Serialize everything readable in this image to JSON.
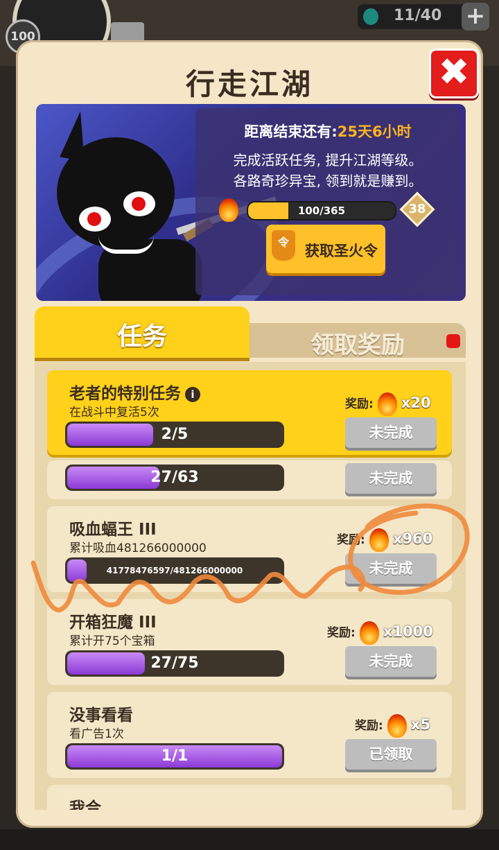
{
  "background": {
    "level": "100",
    "energy": "11/40"
  },
  "dialog": {
    "title": "行走江湖",
    "close_label": "✖"
  },
  "banner": {
    "countdown_label": "距离结束还有:",
    "countdown_value": "25天6小时",
    "desc_line1": "完成活跃任务, 提升江湖等级。",
    "desc_line2": "各路奇珍异宝, 领到就是赚到。",
    "progress_text": "100/365",
    "progress_fraction": 0.274,
    "level": "38",
    "get_token_badge": "令",
    "get_token_label": "获取圣火令"
  },
  "tabs": {
    "tasks": "任务",
    "rewards": "领取奖励"
  },
  "tasks": [
    {
      "name": "老者的特别任务",
      "sub": "在战斗中复活5次",
      "progress": "2/5",
      "fraction": 0.4,
      "reward_label": "奖励:",
      "reward_qty": "x20",
      "button": "未完成"
    },
    {
      "progress": "27/63",
      "fraction": 0.43,
      "button": "未完成"
    },
    {
      "name": "吸血蝠王 III",
      "sub": "累计吸血481266000000",
      "progress": "41778476597/481266000000",
      "fraction": 0.09,
      "reward_label": "奖励:",
      "reward_qty": "x960",
      "button": "未完成"
    },
    {
      "name": "开箱狂魔 III",
      "sub": "累计开75个宝箱",
      "progress": "27/75",
      "fraction": 0.36,
      "reward_label": "奖励:",
      "reward_qty": "x1000",
      "button": "未完成"
    },
    {
      "name": "没事看看",
      "sub": "看广告1次",
      "progress": "1/1",
      "fraction": 1.0,
      "reward_label": "奖励:",
      "reward_qty": "x5",
      "button": "已领取"
    },
    {
      "name": "我合"
    }
  ],
  "colors": {
    "accent_yellow": "#ffd11a",
    "close_red": "#e31c1c",
    "progress_purple": "#8b3ad6",
    "annotation_orange": "#f08a3c"
  }
}
